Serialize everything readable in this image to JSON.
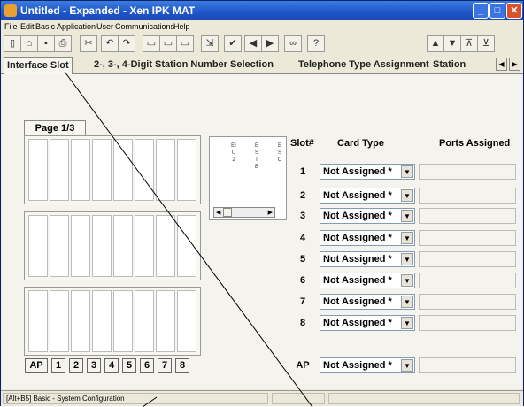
{
  "window": {
    "title": "Untitled - Expanded - Xen IPK MAT"
  },
  "menu": [
    "File",
    "Edit",
    "Basic",
    "Application",
    "User",
    "Communications",
    "Help"
  ],
  "tabs": {
    "items": [
      "Interface Slot",
      "2-, 3-, 4-Digit Station Number Selection",
      "Telephone Type Assignment",
      "Station"
    ]
  },
  "page": {
    "label": "Page 1/3"
  },
  "detail": {
    "cols": [
      "EIU2",
      "ESTB",
      "ESC"
    ]
  },
  "table": {
    "headers": {
      "slot": "Slot#",
      "card": "Card Type",
      "ports": "Ports Assigned"
    },
    "rows": [
      {
        "slot": "1",
        "card": "Not Assigned *"
      },
      {
        "slot": "2",
        "card": "Not Assigned *"
      },
      {
        "slot": "3",
        "card": "Not Assigned *"
      },
      {
        "slot": "4",
        "card": "Not Assigned *"
      },
      {
        "slot": "5",
        "card": "Not Assigned *"
      },
      {
        "slot": "6",
        "card": "Not Assigned *"
      },
      {
        "slot": "7",
        "card": "Not Assigned *"
      },
      {
        "slot": "8",
        "card": "Not Assigned *"
      }
    ],
    "ap": {
      "slot": "AP",
      "card": "Not Assigned *"
    }
  },
  "slot_buttons": [
    "AP",
    "1",
    "2",
    "3",
    "4",
    "5",
    "6",
    "7",
    "8"
  ],
  "status": {
    "text": "[Alt+B5] Basic - System Configuration"
  },
  "colors": {
    "title_bar": "#1e55c8",
    "close": "#d9522b",
    "window_bg": "#ece9d8"
  }
}
